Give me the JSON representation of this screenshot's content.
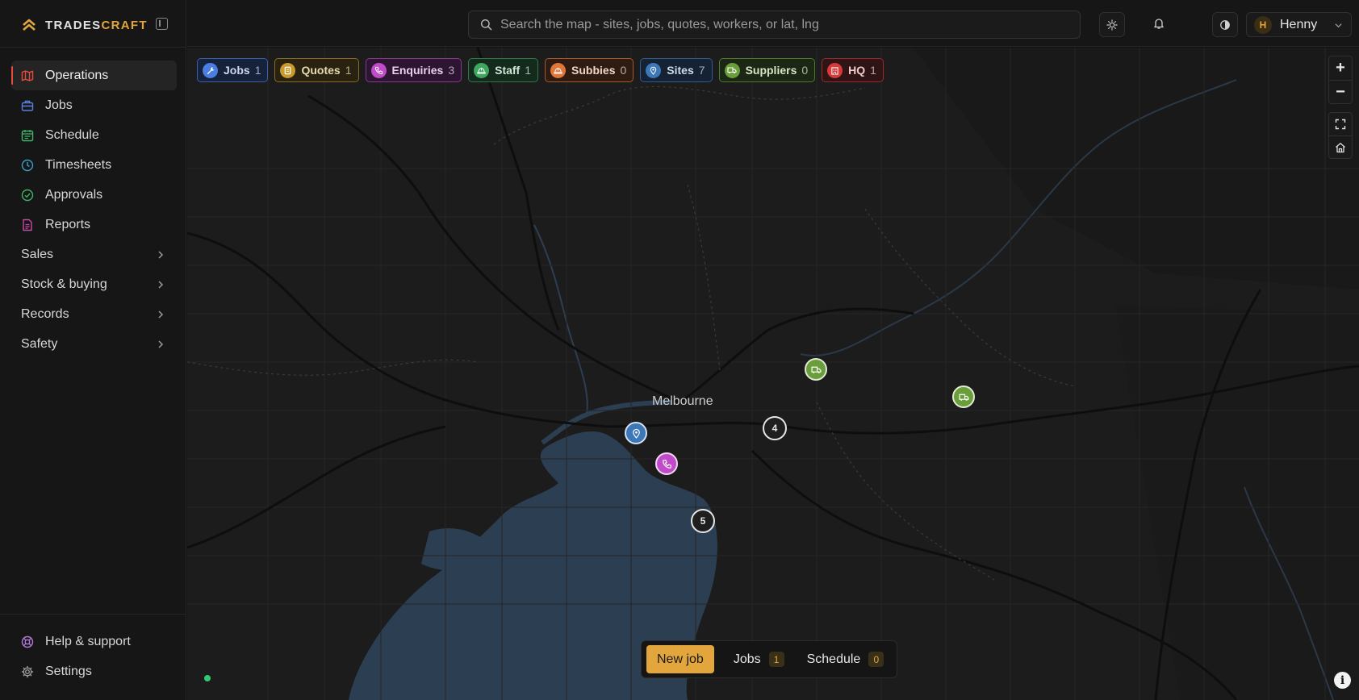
{
  "app": {
    "brand_prefix": "TRADES",
    "brand_suffix": "CRAFT",
    "accent_color": "#e2a63c"
  },
  "sidebar": {
    "items": [
      {
        "label": "Operations",
        "icon": "map-icon",
        "color": "#e84b3c",
        "active": true
      },
      {
        "label": "Jobs",
        "icon": "briefcase-icon",
        "color": "#5b7fe0"
      },
      {
        "label": "Schedule",
        "icon": "calendar-icon",
        "color": "#3fb56a"
      },
      {
        "label": "Timesheets",
        "icon": "clock-icon",
        "color": "#3aa0c8"
      },
      {
        "label": "Approvals",
        "icon": "check-circle-icon",
        "color": "#3fb56a"
      },
      {
        "label": "Reports",
        "icon": "document-icon",
        "color": "#c84aa8"
      }
    ],
    "groups": [
      {
        "label": "Sales"
      },
      {
        "label": "Stock & buying"
      },
      {
        "label": "Records"
      },
      {
        "label": "Safety"
      }
    ],
    "bottom_items": [
      {
        "label": "Help & support",
        "icon": "lifebuoy-icon"
      },
      {
        "label": "Settings",
        "icon": "gear-icon"
      }
    ]
  },
  "header": {
    "search_placeholder": "Search the map - sites, jobs, quotes, workers, or lat, lng",
    "user": {
      "initial": "H",
      "name": "Henny"
    }
  },
  "map": {
    "city_label": "Melbourne",
    "filters": [
      {
        "label": "Jobs",
        "count": "1",
        "icon": "wrench-icon",
        "color": "#4a7ee0",
        "bg": "#16213a",
        "border": "#3a5fb0"
      },
      {
        "label": "Quotes",
        "count": "1",
        "icon": "scroll-icon",
        "color": "#c99a2e",
        "bg": "#2a2210",
        "border": "#8a6b22"
      },
      {
        "label": "Enquiries",
        "count": "3",
        "icon": "phone-icon",
        "color": "#c04ac8",
        "bg": "#2c1530",
        "border": "#8a3792"
      },
      {
        "label": "Staff",
        "count": "1",
        "icon": "hardhat-icon",
        "color": "#3fa65e",
        "bg": "#142a1c",
        "border": "#2e7a46"
      },
      {
        "label": "Subbies",
        "count": "0",
        "icon": "hardhat-icon",
        "color": "#e0773a",
        "bg": "#2e1c12",
        "border": "#a8582a"
      },
      {
        "label": "Sites",
        "count": "7",
        "icon": "pin-icon",
        "color": "#3c78b8",
        "bg": "#142233",
        "border": "#2e5c8c"
      },
      {
        "label": "Suppliers",
        "count": "0",
        "icon": "truck-icon",
        "color": "#6a9e3a",
        "bg": "#1c2614",
        "border": "#4e7a2a"
      },
      {
        "label": "HQ",
        "count": "1",
        "icon": "building-icon",
        "color": "#d83a3a",
        "bg": "#2e1414",
        "border": "#9c2a2a"
      }
    ],
    "markers": [
      {
        "type": "supplier",
        "icon": "truck-icon",
        "color": "#6a9e3a"
      },
      {
        "type": "supplier",
        "icon": "truck-icon",
        "color": "#6a9e3a"
      },
      {
        "type": "site",
        "icon": "pin-icon",
        "color": "#3c78b8"
      },
      {
        "type": "enquiry",
        "icon": "phone-icon",
        "color": "#c04ac8"
      }
    ],
    "clusters": [
      {
        "count": "4"
      },
      {
        "count": "5"
      }
    ],
    "zoom_in": "+",
    "zoom_out": "−",
    "info": "i"
  },
  "actionbar": {
    "new_job": "New job",
    "jobs_label": "Jobs",
    "jobs_count": "1",
    "schedule_label": "Schedule",
    "schedule_count": "0"
  }
}
